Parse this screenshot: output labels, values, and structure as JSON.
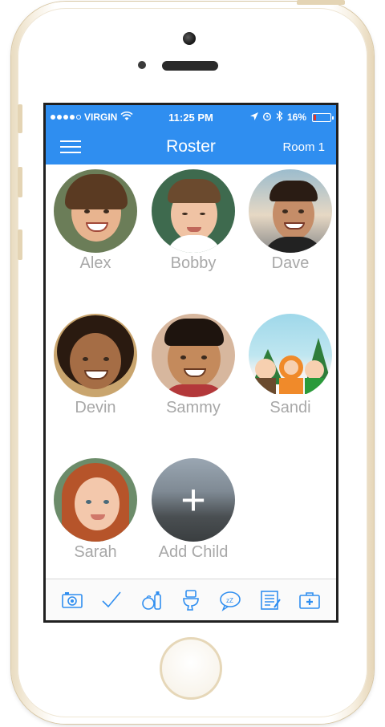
{
  "status_bar": {
    "carrier": "VIRGIN",
    "time": "11:25 PM",
    "battery_percent": "16%",
    "battery_level": 0.16,
    "signal_bars_filled": 4
  },
  "nav_bar": {
    "title": "Roster",
    "room_label": "Room 1"
  },
  "roster": [
    {
      "name": "Alex",
      "skin": "#e8b48f",
      "hair": "#5a3a22",
      "bg": "#6b7d58"
    },
    {
      "name": "Bobby",
      "skin": "#f0c3a4",
      "hair": "#6b4a2e",
      "bg": "#3e6a4e"
    },
    {
      "name": "Dave",
      "skin": "#c58d68",
      "hair": "#2a1c14",
      "bg": "#9cbccd"
    },
    {
      "name": "Devin",
      "skin": "#a56d45",
      "hair": "#2a1a10",
      "bg": "#c9a56e"
    },
    {
      "name": "Sammy",
      "skin": "#c48a5c",
      "hair": "#1e140e",
      "bg": "#d7b79e"
    },
    {
      "name": "Sandi",
      "skin": "#ffffff",
      "hair": "#ffffff",
      "bg": "#9fd8ea"
    },
    {
      "name": "Sarah",
      "skin": "#f3c8ac",
      "hair": "#b6542a",
      "bg": "#6c8c6a"
    }
  ],
  "add_child": {
    "label": "Add Child",
    "icon": "plus-icon"
  },
  "tab_bar": [
    {
      "icon": "camera-icon"
    },
    {
      "icon": "checkmark-icon"
    },
    {
      "icon": "food-icon"
    },
    {
      "icon": "toilet-icon"
    },
    {
      "icon": "sleep-icon"
    },
    {
      "icon": "notes-icon"
    },
    {
      "icon": "first-aid-icon"
    }
  ],
  "colors": {
    "accent": "#2f8ef0",
    "name_text": "#a8a8a8",
    "battery_low": "#e2372b"
  }
}
